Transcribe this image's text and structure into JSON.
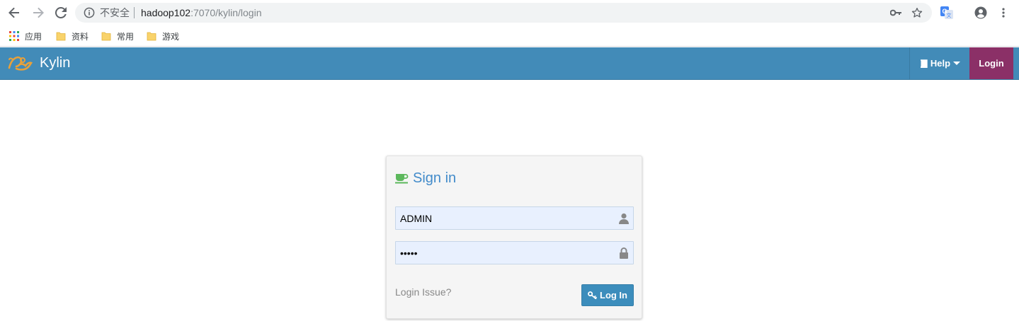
{
  "browser": {
    "security_label": "不安全",
    "url_host": "hadoop102",
    "url_rest": ":7070/kylin/login",
    "bookmarks": [
      {
        "label": "应用",
        "icon": "apps-grid-icon"
      },
      {
        "label": "资料",
        "icon": "folder-icon"
      },
      {
        "label": "常用",
        "icon": "folder-icon"
      },
      {
        "label": "游戏",
        "icon": "folder-icon"
      }
    ]
  },
  "app": {
    "brand": "Kylin",
    "nav": {
      "help_label": "Help",
      "login_label": "Login"
    },
    "login": {
      "title": "Sign in",
      "username_value": "ADMIN",
      "password_value": "•••••",
      "issue_link": "Login Issue?",
      "submit_label": "Log In"
    }
  },
  "colors": {
    "navbar": "#428bb8",
    "login_nav": "#8b3067",
    "title": "#428bca",
    "button": "#3c8dbc",
    "input_bg": "#e8f0fe"
  }
}
